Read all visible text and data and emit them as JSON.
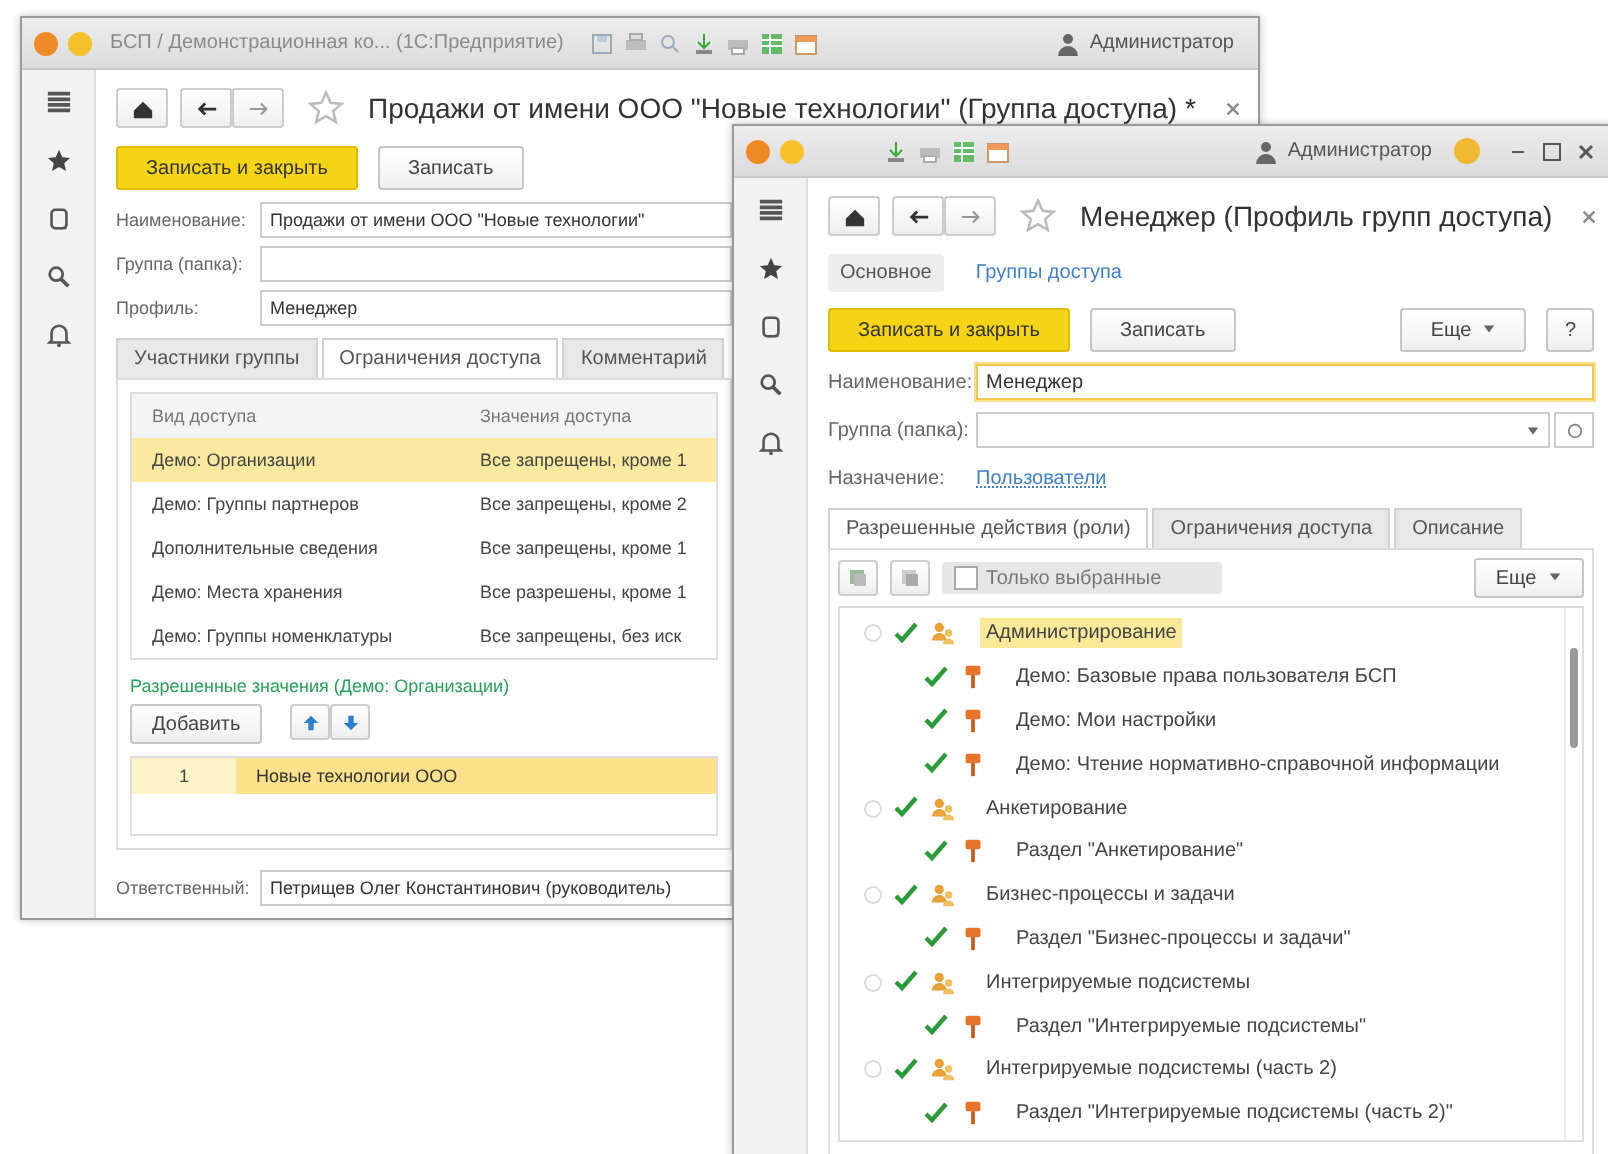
{
  "back_window": {
    "title_bar": {
      "title": "БСП / Демонстрационная ко... (1С:Предприятие)",
      "user": "Администратор"
    },
    "title": "Продажи от имени ООО \"Новые технологии\" (Группа доступа) *",
    "buttons": [
      {
        "label": "Записать и закрыть",
        "kind": "primary"
      },
      {
        "label": "Записать",
        "kind": "default"
      }
    ],
    "fields": [
      {
        "label": "Наименование:",
        "value": "Продажи от имени ООО \"Новые технологии\""
      },
      {
        "label": "Группа (папка):"
      },
      {
        "label": "Профиль:",
        "value": "Менеджер"
      }
    ],
    "tabs": [
      {
        "label": "Участники группы",
        "selected": false
      },
      {
        "label": "Ограничения доступа",
        "selected": true
      },
      {
        "label": "Комментарий",
        "selected": false
      }
    ],
    "table": {
      "columns": [
        "Вид доступа",
        "Значения доступа"
      ],
      "rows": [
        {
          "cells": [
            "Демо: Организации",
            "Все запрещены, кроме 1"
          ],
          "selected": true
        },
        {
          "cells": [
            "Демо: Группы партнеров",
            "Все запрещены, кроме 2"
          ],
          "selected": false
        },
        {
          "cells": [
            "Дополнительные сведения",
            "Все запрещены, кроме 1"
          ],
          "selected": false
        },
        {
          "cells": [
            "Демо: Места хранения",
            "Все разрешены, кроме 1"
          ],
          "selected": false
        },
        {
          "cells": [
            "Демо: Группы номенклатуры",
            "Все запрещены, без иск"
          ],
          "selected": false
        }
      ]
    },
    "allowed_values": {
      "caption": "Разрешенные значения (Демо: Организации)",
      "add_button": "Добавить",
      "rows": [
        {
          "number": "1",
          "value": "Новые технологии ООО",
          "selected": true
        }
      ]
    },
    "responsible": {
      "label": "Ответственный:",
      "value": "Петрищев Олег Константинович (руководитель)"
    }
  },
  "front_window": {
    "title_bar": {
      "user": "Администратор"
    },
    "title": "Менеджер (Профиль групп доступа)",
    "sections": [
      {
        "label": "Основное",
        "selected": true
      },
      {
        "label": "Группы доступа",
        "selected": false
      }
    ],
    "buttons": [
      {
        "label": "Записать и закрыть",
        "kind": "primary"
      },
      {
        "label": "Записать",
        "kind": "default"
      }
    ],
    "more_button": "Еще",
    "help_button": "?",
    "fields": [
      {
        "label": "Наименование:",
        "kind": "text",
        "value": "Менеджер",
        "focused": true
      },
      {
        "label": "Группа (папка):",
        "kind": "select",
        "focused": false
      },
      {
        "label": "Назначение:",
        "kind": "link",
        "value": "Пользователи"
      }
    ],
    "tabs": [
      {
        "label": "Разрешенные действия (роли)",
        "selected": true
      },
      {
        "label": "Ограничения доступа",
        "selected": false
      },
      {
        "label": "Описание",
        "selected": false
      }
    ],
    "toolbar": {
      "only_selected": {
        "label": "Только выбранные",
        "checked": false
      },
      "more_button": "Еще"
    },
    "tree": [
      {
        "label": "Администрирование",
        "checked": true,
        "selected": true,
        "children": [
          {
            "label": "Демо: Базовые права пользователя БСП",
            "checked": true
          },
          {
            "label": "Демо: Мои настройки",
            "checked": true
          },
          {
            "label": "Демо: Чтение нормативно-справочной информации",
            "checked": true
          }
        ]
      },
      {
        "label": "Анкетирование",
        "checked": true,
        "selected": false,
        "children": [
          {
            "label": "Раздел \"Анкетирование\"",
            "checked": true
          }
        ]
      },
      {
        "label": "Бизнес-процессы и задачи",
        "checked": true,
        "selected": false,
        "children": [
          {
            "label": "Раздел \"Бизнес-процессы и задачи\"",
            "checked": true
          }
        ]
      },
      {
        "label": "Интегрируемые подсистемы",
        "checked": true,
        "selected": false,
        "children": [
          {
            "label": "Раздел \"Интегрируемые подсистемы\"",
            "checked": true
          }
        ]
      },
      {
        "label": "Интегрируемые подсистемы (часть 2)",
        "checked": true,
        "selected": false,
        "children": [
          {
            "label": "Раздел \"Интегрируемые подсистемы (часть 2)\"",
            "checked": true
          }
        ]
      }
    ]
  }
}
